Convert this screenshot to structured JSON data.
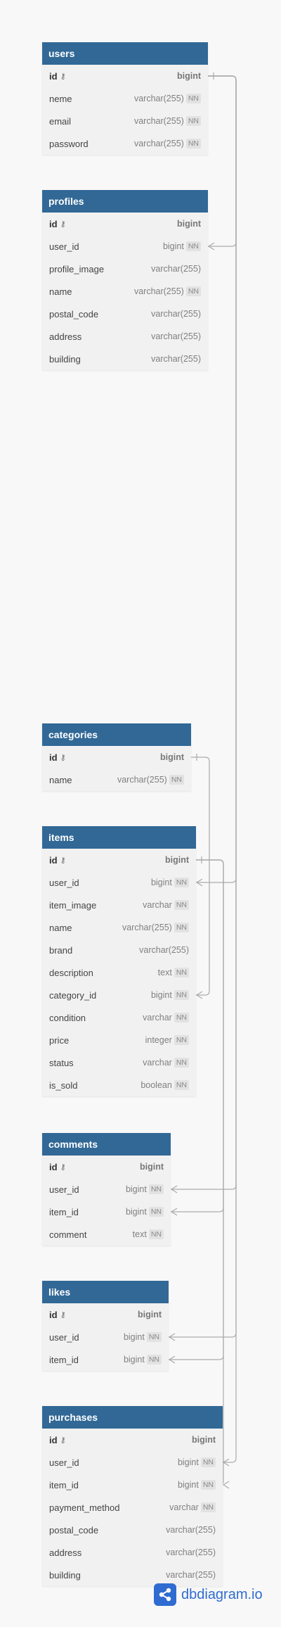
{
  "tables": [
    {
      "name": "users",
      "fields": [
        {
          "name": "id",
          "type": "bigint",
          "pk": true,
          "nn": false
        },
        {
          "name": "neme",
          "type": "varchar(255)",
          "pk": false,
          "nn": true
        },
        {
          "name": "email",
          "type": "varchar(255)",
          "pk": false,
          "nn": true
        },
        {
          "name": "password",
          "type": "varchar(255)",
          "pk": false,
          "nn": true
        }
      ]
    },
    {
      "name": "profiles",
      "fields": [
        {
          "name": "id",
          "type": "bigint",
          "pk": true,
          "nn": false
        },
        {
          "name": "user_id",
          "type": "bigint",
          "pk": false,
          "nn": true
        },
        {
          "name": "profile_image",
          "type": "varchar(255)",
          "pk": false,
          "nn": false
        },
        {
          "name": "name",
          "type": "varchar(255)",
          "pk": false,
          "nn": true
        },
        {
          "name": "postal_code",
          "type": "varchar(255)",
          "pk": false,
          "nn": false
        },
        {
          "name": "address",
          "type": "varchar(255)",
          "pk": false,
          "nn": false
        },
        {
          "name": "building",
          "type": "varchar(255)",
          "pk": false,
          "nn": false
        }
      ]
    },
    {
      "name": "categories",
      "fields": [
        {
          "name": "id",
          "type": "bigint",
          "pk": true,
          "nn": false
        },
        {
          "name": "name",
          "type": "varchar(255)",
          "pk": false,
          "nn": true
        }
      ]
    },
    {
      "name": "items",
      "fields": [
        {
          "name": "id",
          "type": "bigint",
          "pk": true,
          "nn": false
        },
        {
          "name": "user_id",
          "type": "bigint",
          "pk": false,
          "nn": true
        },
        {
          "name": "item_image",
          "type": "varchar",
          "pk": false,
          "nn": true
        },
        {
          "name": "name",
          "type": "varchar(255)",
          "pk": false,
          "nn": true
        },
        {
          "name": "brand",
          "type": "varchar(255)",
          "pk": false,
          "nn": false
        },
        {
          "name": "description",
          "type": "text",
          "pk": false,
          "nn": true
        },
        {
          "name": "category_id",
          "type": "bigint",
          "pk": false,
          "nn": true
        },
        {
          "name": "condition",
          "type": "varchar",
          "pk": false,
          "nn": true
        },
        {
          "name": "price",
          "type": "integer",
          "pk": false,
          "nn": true
        },
        {
          "name": "status",
          "type": "varchar",
          "pk": false,
          "nn": true
        },
        {
          "name": "is_sold",
          "type": "boolean",
          "pk": false,
          "nn": true
        }
      ]
    },
    {
      "name": "comments",
      "fields": [
        {
          "name": "id",
          "type": "bigint",
          "pk": true,
          "nn": false
        },
        {
          "name": "user_id",
          "type": "bigint",
          "pk": false,
          "nn": true
        },
        {
          "name": "item_id",
          "type": "bigint",
          "pk": false,
          "nn": true
        },
        {
          "name": "comment",
          "type": "text",
          "pk": false,
          "nn": true
        }
      ]
    },
    {
      "name": "likes",
      "fields": [
        {
          "name": "id",
          "type": "bigint",
          "pk": true,
          "nn": false
        },
        {
          "name": "user_id",
          "type": "bigint",
          "pk": false,
          "nn": true
        },
        {
          "name": "item_id",
          "type": "bigint",
          "pk": false,
          "nn": true
        }
      ]
    },
    {
      "name": "purchases",
      "fields": [
        {
          "name": "id",
          "type": "bigint",
          "pk": true,
          "nn": false
        },
        {
          "name": "user_id",
          "type": "bigint",
          "pk": false,
          "nn": true
        },
        {
          "name": "item_id",
          "type": "bigint",
          "pk": false,
          "nn": true
        },
        {
          "name": "payment_method",
          "type": "varchar",
          "pk": false,
          "nn": true
        },
        {
          "name": "postal_code",
          "type": "varchar(255)",
          "pk": false,
          "nn": false
        },
        {
          "name": "address",
          "type": "varchar(255)",
          "pk": false,
          "nn": false
        },
        {
          "name": "building",
          "type": "varchar(255)",
          "pk": false,
          "nn": false
        }
      ]
    }
  ],
  "relations": [
    {
      "from": "users.id",
      "to": "profiles.user_id"
    },
    {
      "from": "users.id",
      "to": "items.user_id"
    },
    {
      "from": "users.id",
      "to": "comments.user_id"
    },
    {
      "from": "users.id",
      "to": "likes.user_id"
    },
    {
      "from": "users.id",
      "to": "purchases.user_id"
    },
    {
      "from": "categories.id",
      "to": "items.category_id"
    },
    {
      "from": "items.id",
      "to": "comments.item_id"
    },
    {
      "from": "items.id",
      "to": "likes.item_id"
    },
    {
      "from": "items.id",
      "to": "purchases.item_id"
    }
  ],
  "labels": {
    "not_null": "NN"
  },
  "brand": {
    "text": "dbdiagram.io"
  },
  "colors": {
    "header": "#316896",
    "row": "#f1f1f1",
    "line": "#aaaaaa",
    "brand": "#2f6cd1"
  }
}
